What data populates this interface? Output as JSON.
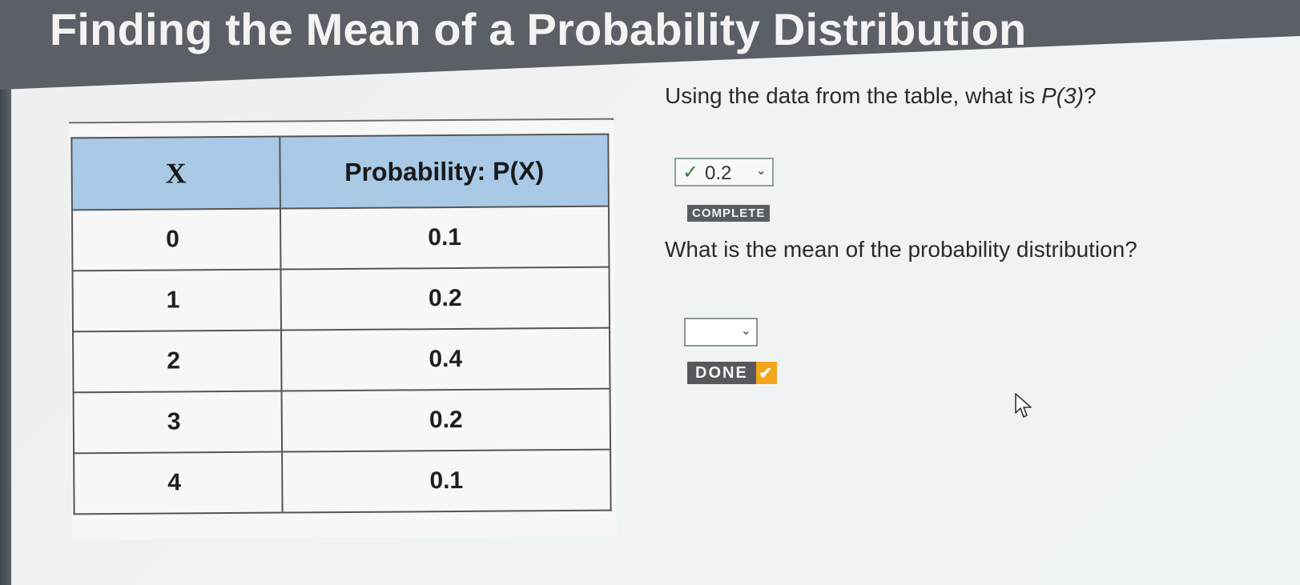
{
  "title": "Finding the Mean of a Probability Distribution",
  "table": {
    "headers": [
      "X",
      "Probability: P(X)"
    ],
    "rows": [
      [
        "0",
        "0.1"
      ],
      [
        "1",
        "0.2"
      ],
      [
        "2",
        "0.4"
      ],
      [
        "3",
        "0.2"
      ],
      [
        "4",
        "0.1"
      ]
    ]
  },
  "question1": {
    "text_before": "Using the data from the table, what is ",
    "math": "P(3)",
    "text_after": "?",
    "selected_value": "0.2",
    "status": "COMPLETE"
  },
  "question2": {
    "text": "What is the mean of the probability distribution?",
    "selected_value": ""
  },
  "done_label": "DONE",
  "icons": {
    "check": "check-icon",
    "chevron": "chevron-down-icon",
    "done_check": "checkmark-badge-icon",
    "cursor": "mouse-pointer-icon"
  },
  "colors": {
    "header_bg": "#5b6066",
    "table_header": "#a9c9e6",
    "done_accent": "#f2a51b"
  }
}
